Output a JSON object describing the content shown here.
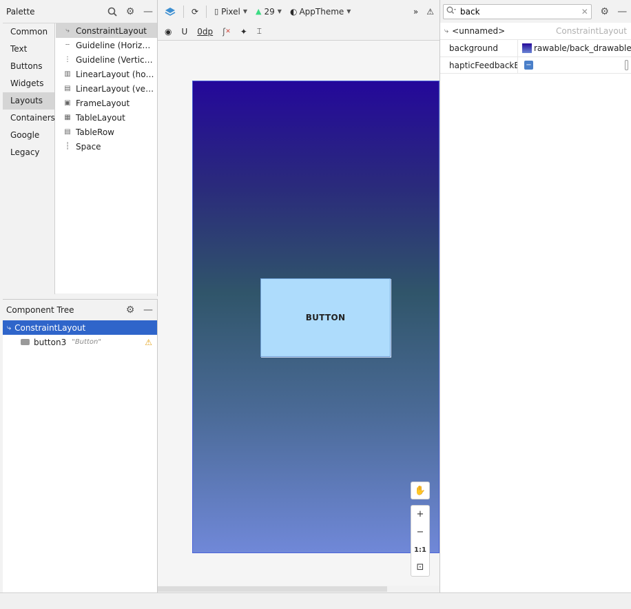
{
  "palette": {
    "title": "Palette",
    "categories": [
      "Common",
      "Text",
      "Buttons",
      "Widgets",
      "Layouts",
      "Containers",
      "Google",
      "Legacy"
    ],
    "selected_category": "Layouts",
    "widgets": [
      {
        "label": "ConstraintLayout",
        "icon": "constraint-layout-icon"
      },
      {
        "label": "Guideline (Horiz…",
        "icon": "guideline-horizontal-icon"
      },
      {
        "label": "Guideline (Vertic…",
        "icon": "guideline-vertical-icon"
      },
      {
        "label": "LinearLayout (ho…",
        "icon": "linear-layout-horizontal-icon"
      },
      {
        "label": "LinearLayout (ve…",
        "icon": "linear-layout-vertical-icon"
      },
      {
        "label": "FrameLayout",
        "icon": "frame-layout-icon"
      },
      {
        "label": "TableLayout",
        "icon": "table-layout-icon"
      },
      {
        "label": "TableRow",
        "icon": "table-row-icon"
      },
      {
        "label": "Space",
        "icon": "space-icon"
      }
    ]
  },
  "tree": {
    "title": "Component Tree",
    "root": "ConstraintLayout",
    "child_id": "button3",
    "child_text": "\"Button\""
  },
  "toolbar": {
    "device": "Pixel",
    "api": "29",
    "theme": "AppTheme",
    "margin": "0dp"
  },
  "canvas": {
    "button_label": "BUTTON",
    "zoom_ratio": "1:1"
  },
  "attributes": {
    "search_value": "back",
    "component_name": "<unnamed>",
    "component_class": "ConstraintLayout",
    "rows": [
      {
        "key": "background",
        "value": "rawable/back_drawable"
      },
      {
        "key": "hapticFeedbackEn…",
        "value": ""
      }
    ]
  },
  "colors": {
    "selection": "#2f65ca",
    "button_fill": "#aedcfc",
    "gradient_top": "#24089a",
    "gradient_bottom": "#7088d8",
    "warning": "#e3a21a"
  }
}
